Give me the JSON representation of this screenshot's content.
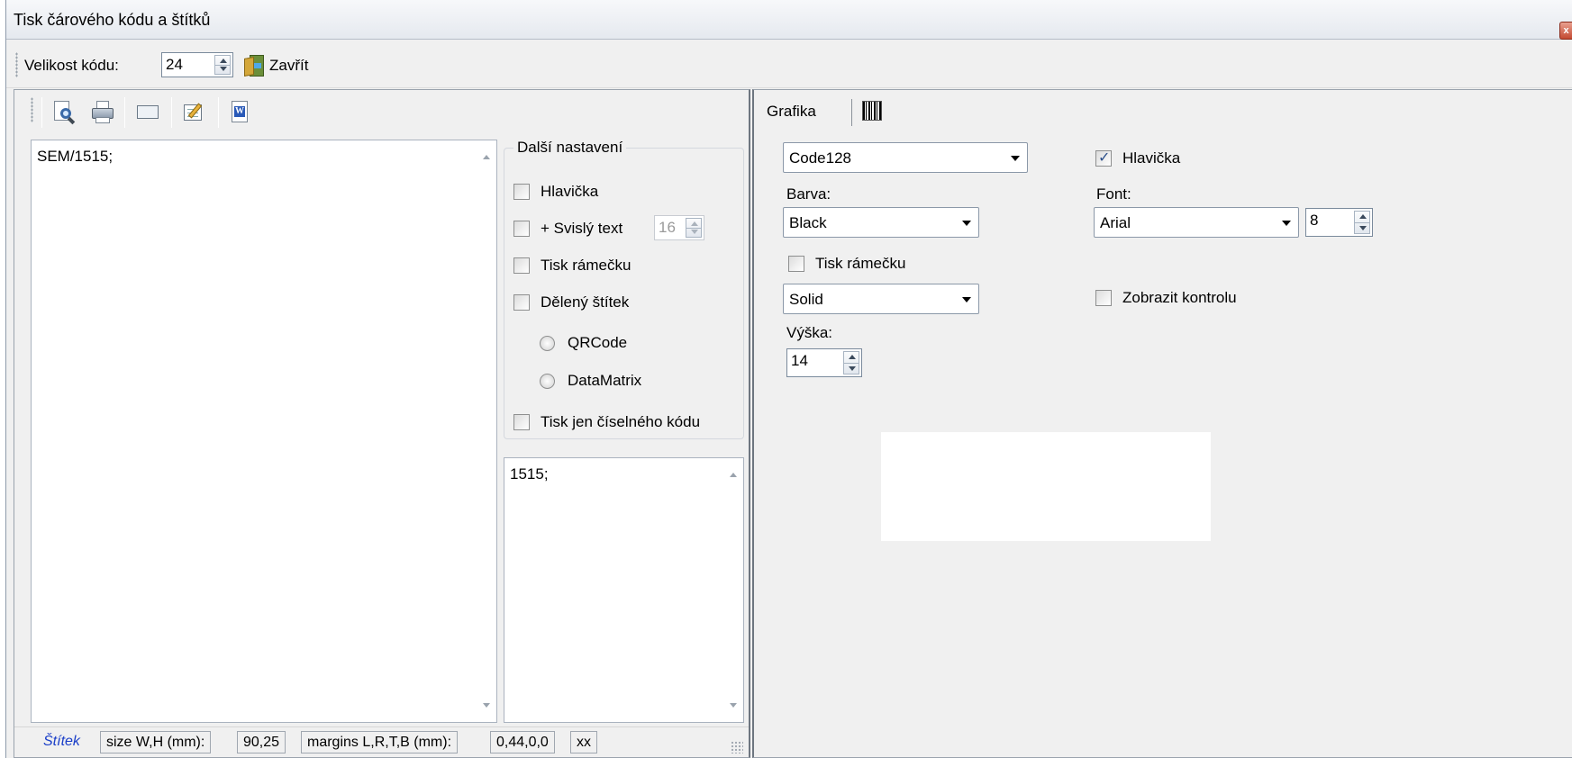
{
  "window": {
    "title": "Tisk čárového kódu a štítků",
    "close_glyph": "x"
  },
  "toolbar": {
    "size_label": "Velikost kódu:",
    "size_value": "24",
    "close_label": "Zavřít"
  },
  "left_toolbar": {
    "icons": [
      "preview-icon",
      "print-icon",
      "keyboard-icon",
      "edit-icon",
      "word-icon"
    ]
  },
  "main_memo": {
    "text": "SEM/1515;"
  },
  "settings": {
    "title": "Další nastavení",
    "header": "Hlavička",
    "vertical_text": "+ Svislý text",
    "vertical_value": "16",
    "frame": "Tisk rámečku",
    "split": "Dělený štítek",
    "qrcode": "QRCode",
    "datamatrix": "DataMatrix",
    "numeric_only": "Tisk jen číselného kódu"
  },
  "code_memo": {
    "text": "1515;"
  },
  "statusbar": {
    "label": "Štítek",
    "size_label": "size W,H (mm):",
    "size_value": "90,25",
    "margins_label": "margins L,R,T,B (mm):",
    "margins_value": "0,44,0,0",
    "extra": "xx"
  },
  "right": {
    "tab_label": "Grafika",
    "barcode_type": "Code128",
    "header_label": "Hlavička",
    "header_checked": true,
    "color_label": "Barva:",
    "color_value": "Black",
    "font_label": "Font:",
    "font_value": "Arial",
    "font_size": "8",
    "frame_label": "Tisk rámečku",
    "line_style": "Solid",
    "show_check_label": "Zobrazit kontrolu",
    "height_label": "Výška:",
    "height_value": "14"
  }
}
